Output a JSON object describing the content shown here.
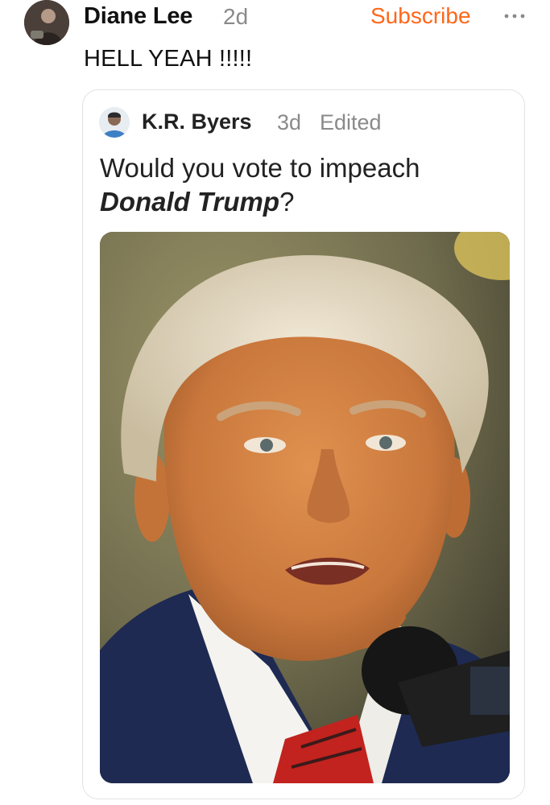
{
  "note": {
    "author": {
      "name": "Diane Lee",
      "time": "2d"
    },
    "subscribe_label": "Subscribe",
    "more_icon": "ellipsis-icon",
    "text": "HELL YEAH !!!!!"
  },
  "quoted": {
    "author": {
      "name": "K.R. Byers",
      "time": "3d",
      "edited": "Edited"
    },
    "text_part1": "Would you vote to impeach",
    "text_emphasis": "Donald Trump",
    "text_end": "?",
    "image": "photo of a man with white hair in a suit and red tie speaking at a microphone"
  },
  "colors": {
    "accent": "#ff6719",
    "muted": "#8a8a8a",
    "border": "#e3e3e3"
  }
}
